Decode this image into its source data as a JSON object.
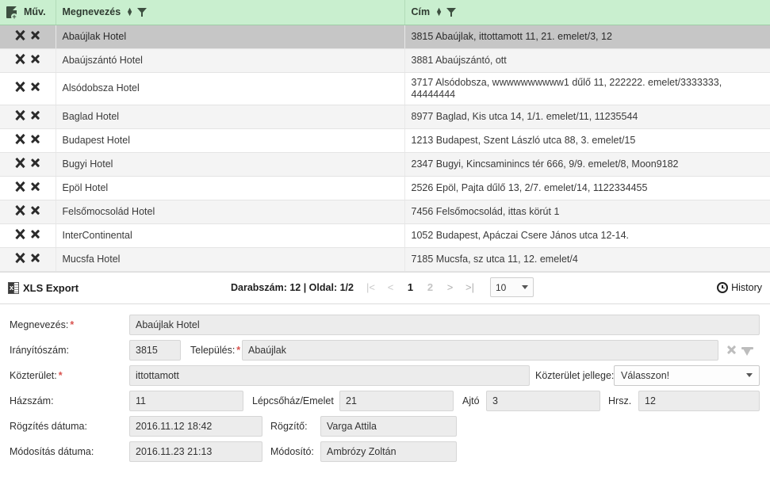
{
  "grid": {
    "columns": [
      {
        "key": "actions",
        "label": "Műv.",
        "icon": "new-document-icon",
        "sortable": false,
        "filterable": false
      },
      {
        "key": "name",
        "label": "Megnevezés",
        "sortable": true,
        "filterable": true
      },
      {
        "key": "address",
        "label": "Cím",
        "sortable": true,
        "filterable": true
      }
    ],
    "row_action_icons": [
      "wrench-icon",
      "delete-x-icon"
    ],
    "rows": [
      {
        "name": "Abaújlak Hotel",
        "address": "3815 Abaújlak, ittottamott 11, 21. emelet/3, 12",
        "selected": true
      },
      {
        "name": "Abaújszántó Hotel",
        "address": "3881 Abaújszántó, ott",
        "selected": false
      },
      {
        "name": "Alsódobsza Hotel",
        "address": "3717 Alsódobsza, wwwwwwwwww1 dűlő 11, 222222. emelet/3333333, 44444444",
        "selected": false
      },
      {
        "name": "Baglad Hotel",
        "address": "8977 Baglad, Kis utca 14, 1/1. emelet/11, 11235544",
        "selected": false
      },
      {
        "name": "Budapest Hotel",
        "address": "1213 Budapest, Szent László utca 88, 3. emelet/15",
        "selected": false
      },
      {
        "name": "Bugyi Hotel",
        "address": "2347 Bugyi, Kincsaminincs tér 666, 9/9. emelet/8, Moon9182",
        "selected": false
      },
      {
        "name": "Epöl Hotel",
        "address": "2526 Epöl, Pajta dűlő 13, 2/7. emelet/14, 1122334455",
        "selected": false
      },
      {
        "name": "Felsőmocsolád Hotel",
        "address": "7456 Felsőmocsolád, ittas körút 1",
        "selected": false
      },
      {
        "name": "InterContinental",
        "address": "1052 Budapest, Apáczai Csere János utca 12-14.",
        "selected": false
      },
      {
        "name": "Mucsfa Hotel",
        "address": "7185 Mucsfa, sz utca 11, 12. emelet/4",
        "selected": false
      }
    ]
  },
  "toolbar": {
    "xls_export_label": "XLS Export",
    "pager_info": "Darabszám: 12 | Oldal: 1/2",
    "pages": [
      {
        "label": "|<",
        "name": "first",
        "type": "arrow",
        "enabled": false
      },
      {
        "label": "<",
        "name": "prev",
        "type": "arrow",
        "enabled": false
      },
      {
        "label": "1",
        "name": "page-1",
        "type": "num",
        "current": true
      },
      {
        "label": "2",
        "name": "page-2",
        "type": "num",
        "current": false
      },
      {
        "label": ">",
        "name": "next",
        "type": "arrow",
        "enabled": true
      },
      {
        "label": ">|",
        "name": "last",
        "type": "arrow",
        "enabled": true
      }
    ],
    "page_size": "10",
    "history_label": "History"
  },
  "form": {
    "megnevezes": {
      "label": "Megnevezés:",
      "required": true,
      "value": "Abaújlak Hotel"
    },
    "iranyitoszam": {
      "label": "Irányítószám:",
      "required": false,
      "value": "3815"
    },
    "telepules": {
      "label": "Település:",
      "required": true,
      "value": "Abaújlak"
    },
    "kozterulet": {
      "label": "Közterület:",
      "required": true,
      "value": "ittottamott"
    },
    "kozterulet_jellege": {
      "label": "Közterület jellege:",
      "value": "Válasszon!"
    },
    "hazszam": {
      "label": "Házszám:",
      "value": "11"
    },
    "lepcsohaz_emelet": {
      "label": "Lépcsőház/Emelet",
      "value": "21"
    },
    "ajto": {
      "label": "Ajtó",
      "value": "3"
    },
    "hrsz": {
      "label": "Hrsz.",
      "value": "12"
    },
    "rogzites_datuma": {
      "label": "Rögzítés dátuma:",
      "value": "2016.11.12 18:42"
    },
    "rogzito": {
      "label": "Rögzítő:",
      "value": "Varga Attila"
    },
    "modositas_datuma": {
      "label": "Módosítás dátuma:",
      "value": "2016.11.23 21:13"
    },
    "modosito": {
      "label": "Módosító:",
      "value": "Ambrózy Zoltán"
    }
  },
  "colors": {
    "header_green": "#c9efcf",
    "selected_row": "#c6c6c6",
    "stripe": "#f4f4f4",
    "required_asterisk": "#d9534f"
  }
}
